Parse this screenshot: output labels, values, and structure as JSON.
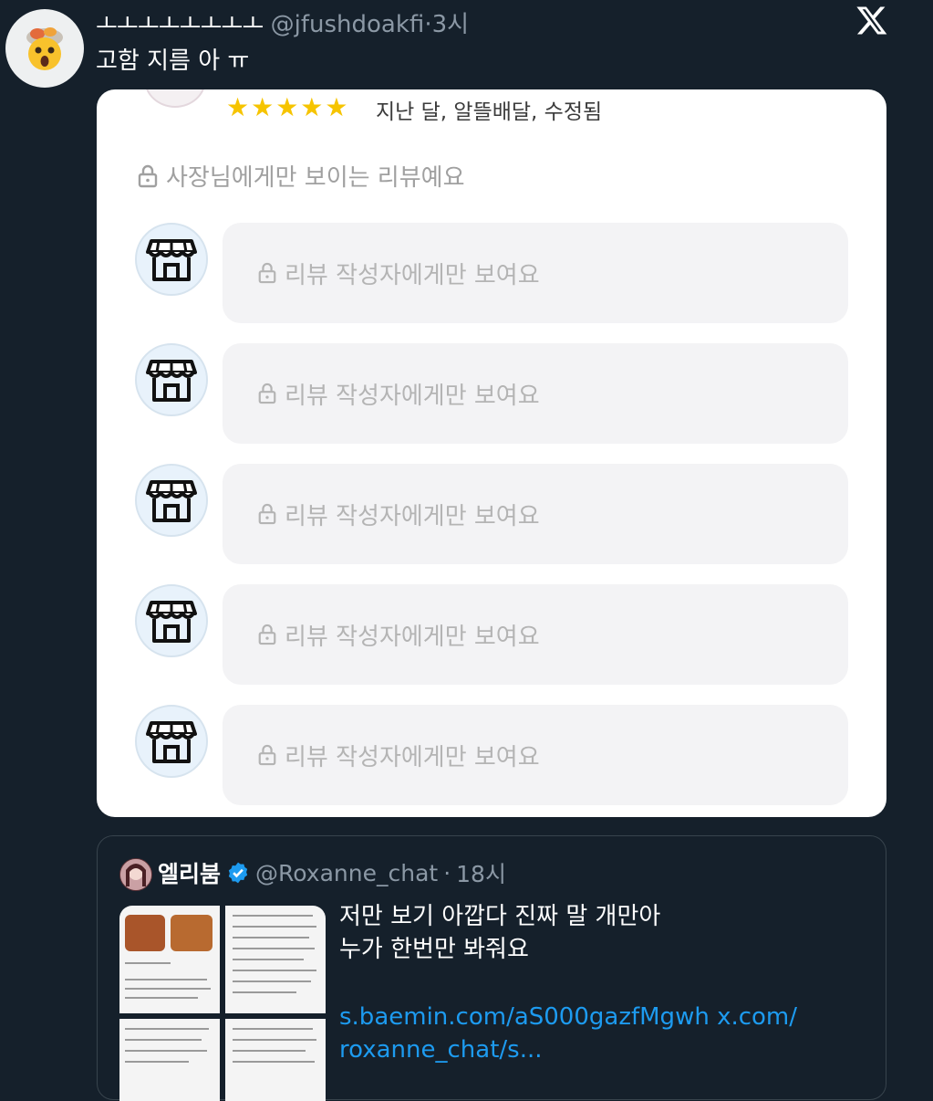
{
  "tweet": {
    "display_name": "ㅗㅗㅗㅗㅗㅗㅗㅗ",
    "handle": "@jfushdoakfi",
    "separator": "·",
    "time": "3시",
    "text": "고함 지름 아 ㅠ",
    "avatar_icon": "exploding-head-emoji-icon"
  },
  "review_card": {
    "stars": "★★★★★",
    "rating": 5,
    "meta": "지난 달, 알뜰배달, 수정됨",
    "owner_only_text": "사장님에게만 보이는 리뷰예요",
    "replies": [
      {
        "text": "리뷰 작성자에게만 보여요"
      },
      {
        "text": "리뷰 작성자에게만 보여요"
      },
      {
        "text": "리뷰 작성자에게만 보여요"
      },
      {
        "text": "리뷰 작성자에게만 보여요"
      },
      {
        "text": "리뷰 작성자에게만 보여요"
      }
    ]
  },
  "quote": {
    "name": "엘리붐",
    "verified": true,
    "handle": "@Roxanne_chat",
    "separator": "·",
    "time": "18시",
    "text_line1": "저만 보기 아깝다 진짜 말 개만아",
    "text_line2": "누가 한번만 봐줘요",
    "link_line1": "s.baemin.com/aS000gazfMgwh x.com/",
    "link_line2": "roxanne_chat/s..."
  },
  "colors": {
    "background": "#15202b",
    "link": "#1d9bf0",
    "star": "#f6c400",
    "verified": "#1d9bf0"
  }
}
